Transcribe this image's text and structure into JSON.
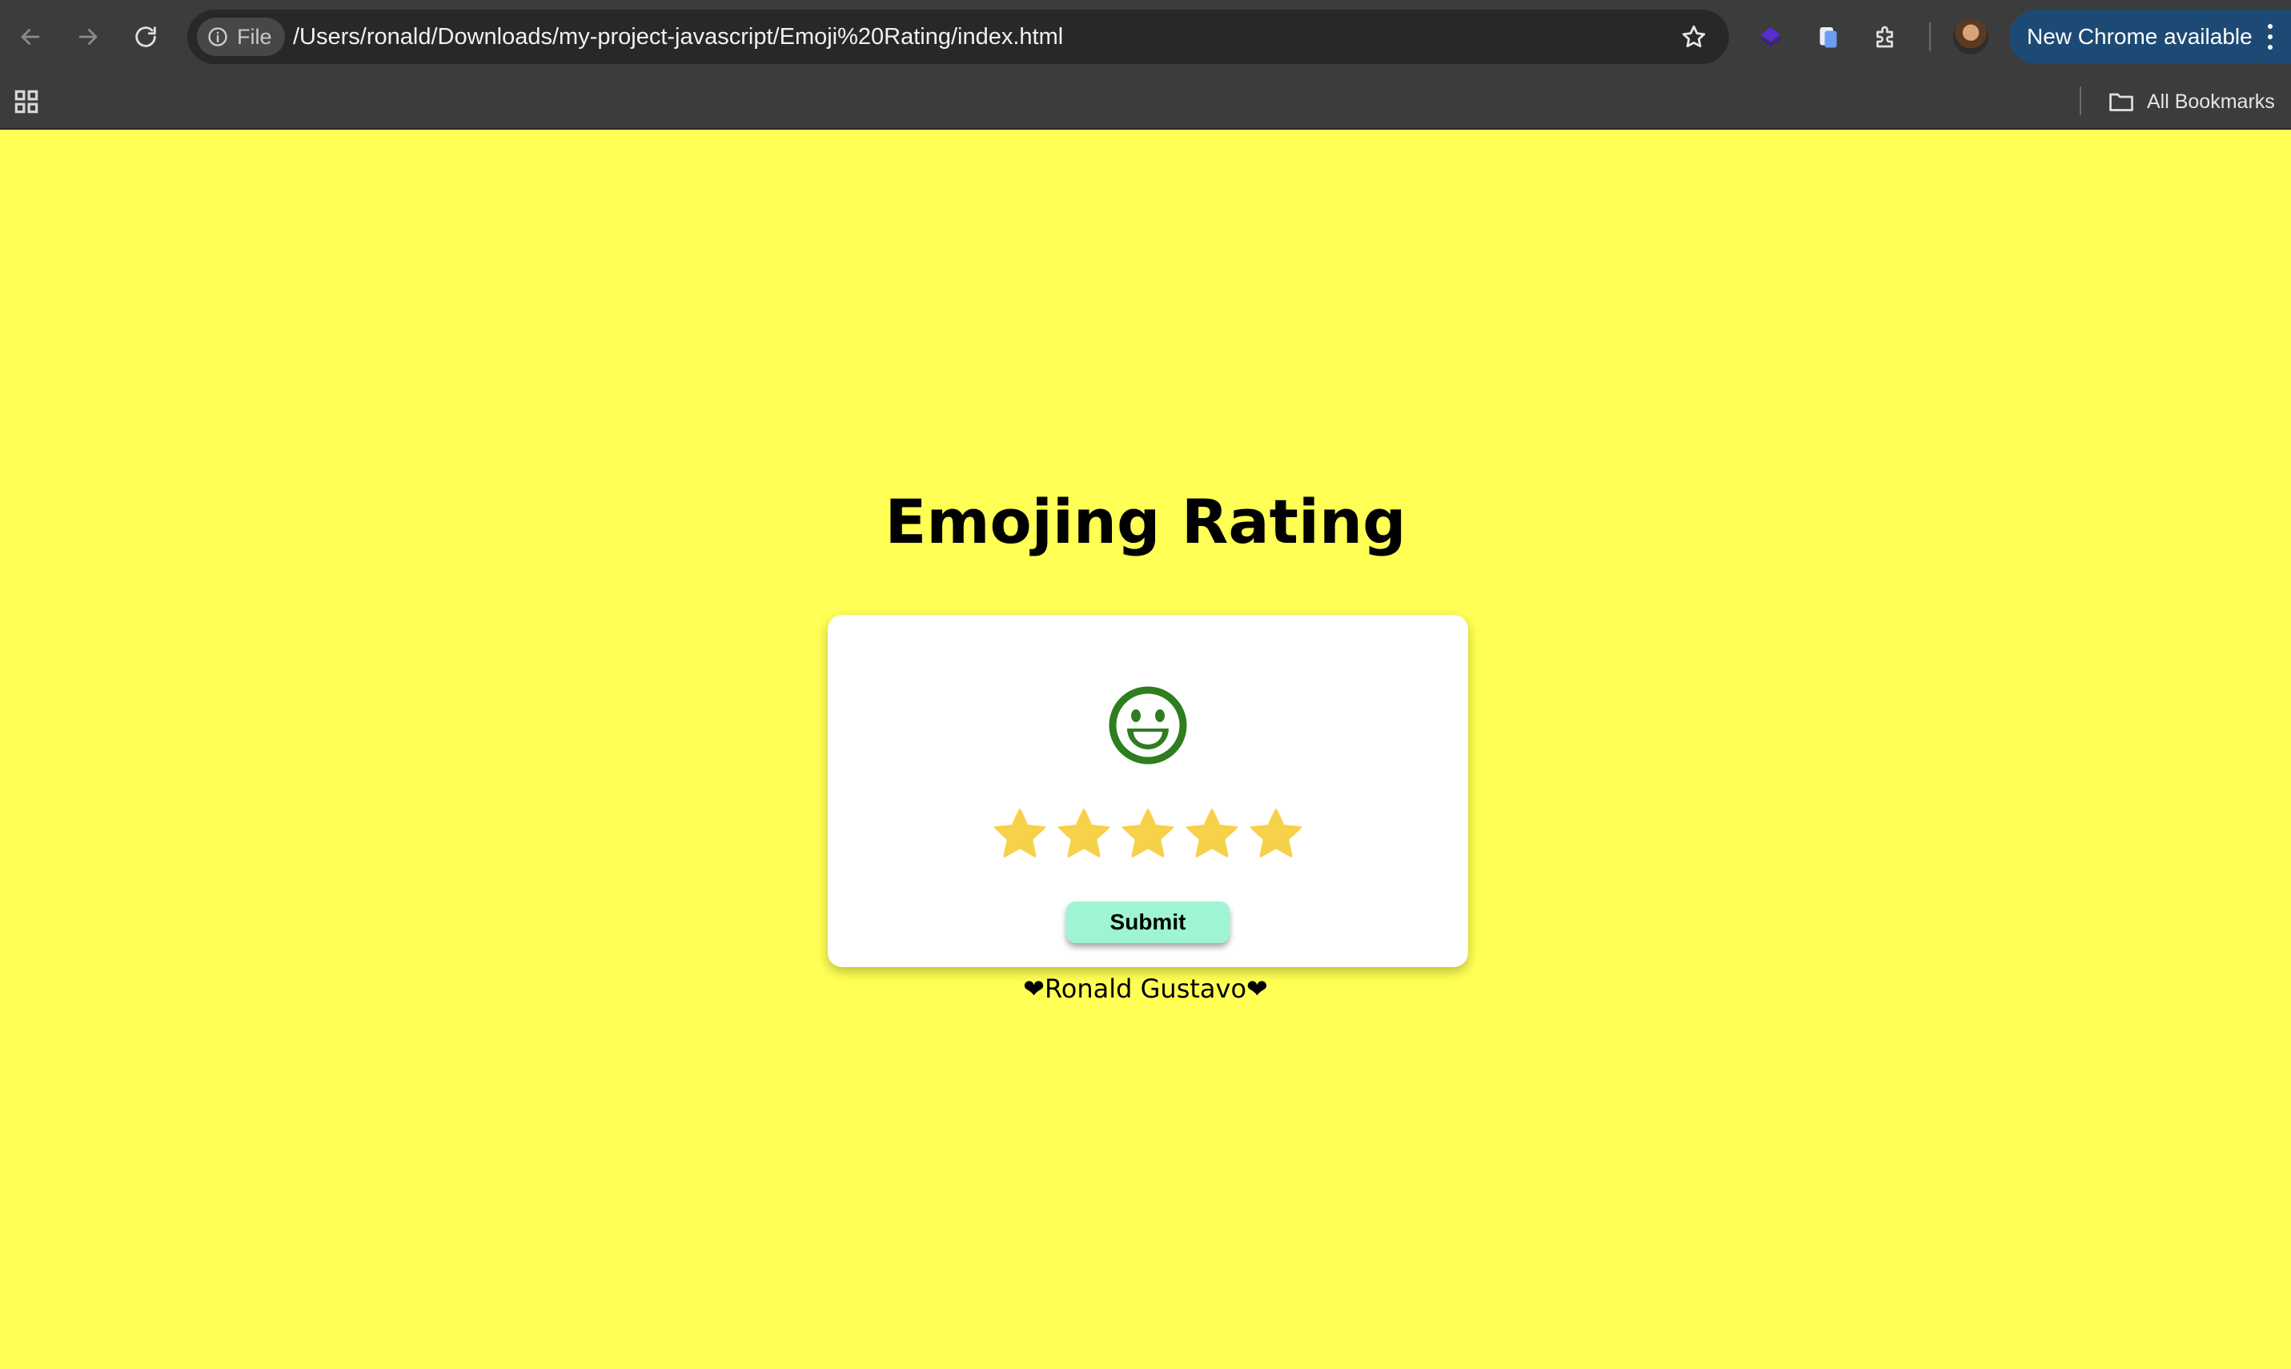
{
  "browser": {
    "url_chip_label": "File",
    "url": "/Users/ronald/Downloads/my-project-javascript/Emoji%20Rating/index.html",
    "update_label": "New Chrome available",
    "bookmarks_label": "All Bookmarks",
    "icons": {
      "back": "arrow-left-icon",
      "forward": "arrow-right-icon",
      "reload": "reload-icon",
      "site_info": "info-icon",
      "bookmark": "star-outline-icon",
      "extension_1": "purple-extension-icon",
      "extension_2": "blue-document-icon",
      "extensions": "puzzle-icon",
      "menu": "three-dots-vertical-icon",
      "apps": "apps-grid-icon",
      "folder": "folder-icon"
    }
  },
  "page": {
    "title": "Emojing Rating",
    "rating": {
      "current": 5,
      "max": 5,
      "emoji": "grinning-face-icon",
      "emoji_color": "#2e7d1f",
      "star_color": "#f6d14a"
    },
    "submit_label": "Submit",
    "credit": "❤Ronald Gustavo❤"
  },
  "colors": {
    "page_background": "#ffff55",
    "card_background": "#ffffff",
    "submit_background": "#9ff5d3",
    "browser_chrome": "#3c3c3c",
    "update_chip": "#1d4a74"
  }
}
